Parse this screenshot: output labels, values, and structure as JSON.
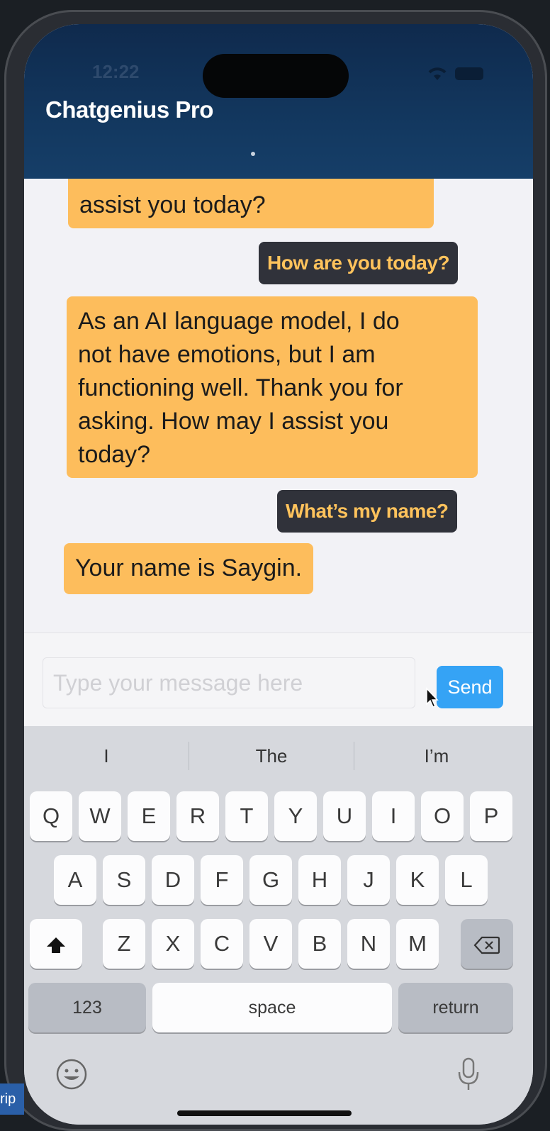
{
  "status_bar": {
    "time": "12:22"
  },
  "header": {
    "title": "Chatgenius Pro"
  },
  "messages": [
    {
      "role": "bot",
      "text": "assist you today?"
    },
    {
      "role": "user",
      "text": "How are you today?"
    },
    {
      "role": "bot",
      "lines": [
        "As an AI language model, I do",
        "not have emotions, but I am",
        "functioning well. Thank you for",
        "asking. How may I assist you",
        "today?"
      ]
    },
    {
      "role": "user",
      "text": "What’s my name?"
    },
    {
      "role": "bot",
      "text": "Your name is Saygin."
    }
  ],
  "composer": {
    "placeholder": "Type your message here",
    "send_label": "Send"
  },
  "keyboard": {
    "suggestions": [
      "I",
      "The",
      "I’m"
    ],
    "row1": [
      "Q",
      "W",
      "E",
      "R",
      "T",
      "Y",
      "U",
      "I",
      "O",
      "P"
    ],
    "row2": [
      "A",
      "S",
      "D",
      "F",
      "G",
      "H",
      "J",
      "K",
      "L"
    ],
    "row3": [
      "Z",
      "X",
      "C",
      "V",
      "B",
      "N",
      "M"
    ],
    "numbers_label": "123",
    "space_label": "space",
    "return_label": "return",
    "icons": [
      "shift-icon",
      "backspace-icon",
      "emoji-icon",
      "microphone-icon"
    ]
  },
  "background_edge_text": "rip",
  "colors": {
    "header": "#133961",
    "bot_bubble": "#fdbd5c",
    "user_bubble": "#30323a",
    "user_text": "#ffc35c",
    "send": "#35a3f5"
  }
}
